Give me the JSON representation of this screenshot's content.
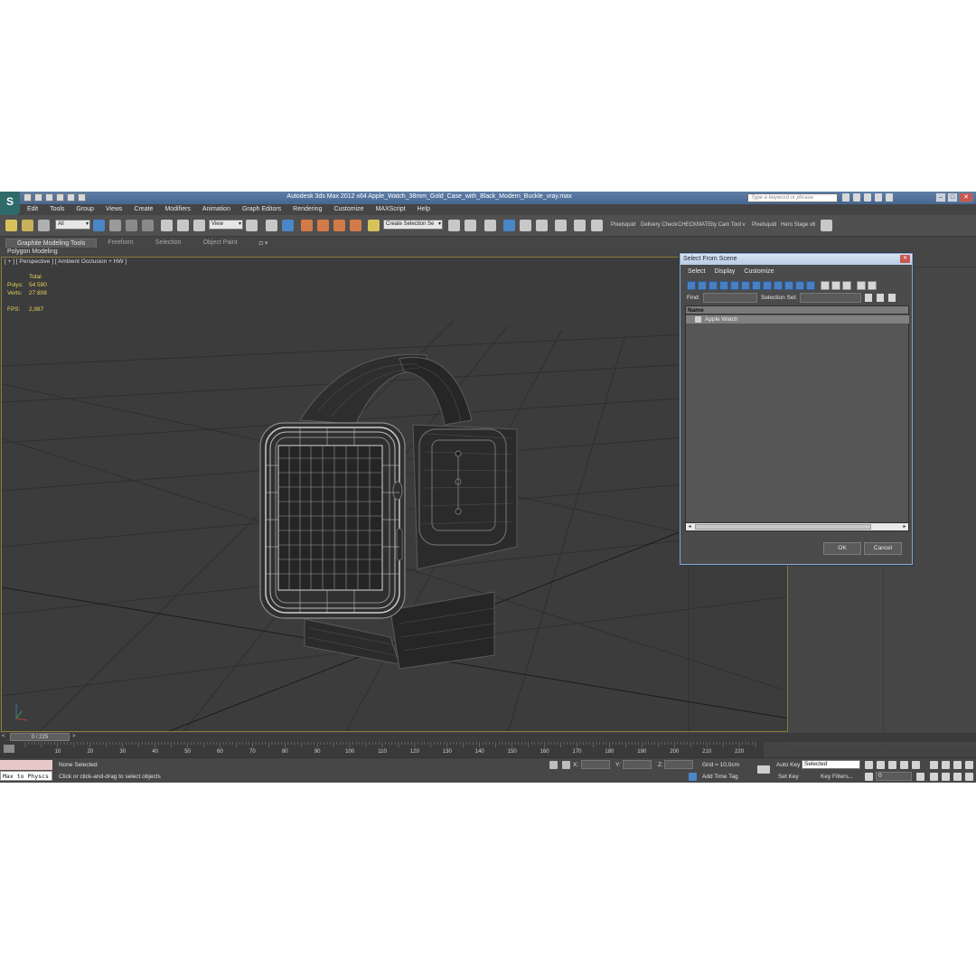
{
  "app": {
    "logo": "S",
    "window_title": "Autodesk 3ds Max  2012 x64      Apple_Watch_38mm_Gold_Case_with_Black_Modern_Buckle_vray.max",
    "search_placeholder": "Type a keyword or phrase"
  },
  "menu": [
    "Edit",
    "Tools",
    "Group",
    "Views",
    "Create",
    "Modifiers",
    "Animation",
    "Graph Editors",
    "Rendering",
    "Customize",
    "MAXScript",
    "Help"
  ],
  "toolbar": {
    "selection_filter": "All",
    "ref_coord": "View",
    "named_selection": "Create Selection Se",
    "plugins": [
      "Pixelsquid",
      "Delivery Check",
      "CHECKMATE",
      "ity Cam Tool v",
      "Pixelsquid",
      "Hero Stage v6"
    ]
  },
  "ribbon": {
    "tabs": [
      "Graphite Modeling Tools",
      "Freeform",
      "Selection",
      "Object Paint"
    ],
    "active_tab": "Graphite Modeling Tools",
    "sub_label": "Polygon Modeling"
  },
  "viewport": {
    "label": "[ + ] [ Perspective ] [ Ambient Occlusion + HW ]",
    "stats": {
      "header": "Total",
      "polys_label": "Polys:",
      "polys_value": "54 590",
      "verts_label": "Verts:",
      "verts_value": "27 808",
      "fps_label": "FPS:",
      "fps_value": "2,987"
    }
  },
  "dialog": {
    "title": "Select From Scene",
    "menu": [
      "Select",
      "Display",
      "Customize"
    ],
    "find_label": "Find:",
    "selection_set_label": "Selection Set:",
    "list_header": "Name",
    "items": [
      "Apple Watch"
    ],
    "ok_label": "OK",
    "cancel_label": "Cancel"
  },
  "timeline": {
    "frame_readout": "0 / 225",
    "ticks": [
      "10",
      "20",
      "30",
      "40",
      "50",
      "60",
      "70",
      "80",
      "90",
      "100",
      "110",
      "120",
      "130",
      "140",
      "150",
      "160",
      "170",
      "180",
      "190",
      "200",
      "210",
      "220"
    ]
  },
  "status": {
    "maxscript_label": "Max to Physcs",
    "selection_status": "None Selected",
    "prompt": "Click or click-and-drag to select objects",
    "x_label": "X:",
    "y_label": "Y:",
    "z_label": "Z:",
    "grid": "Grid = 10,0cm",
    "add_time_tag": "Add Time Tag",
    "auto_key": "Auto Key",
    "set_key": "Set Key",
    "key_mode": "Selected",
    "key_filters": "Key Filters...",
    "current_frame": "0"
  }
}
